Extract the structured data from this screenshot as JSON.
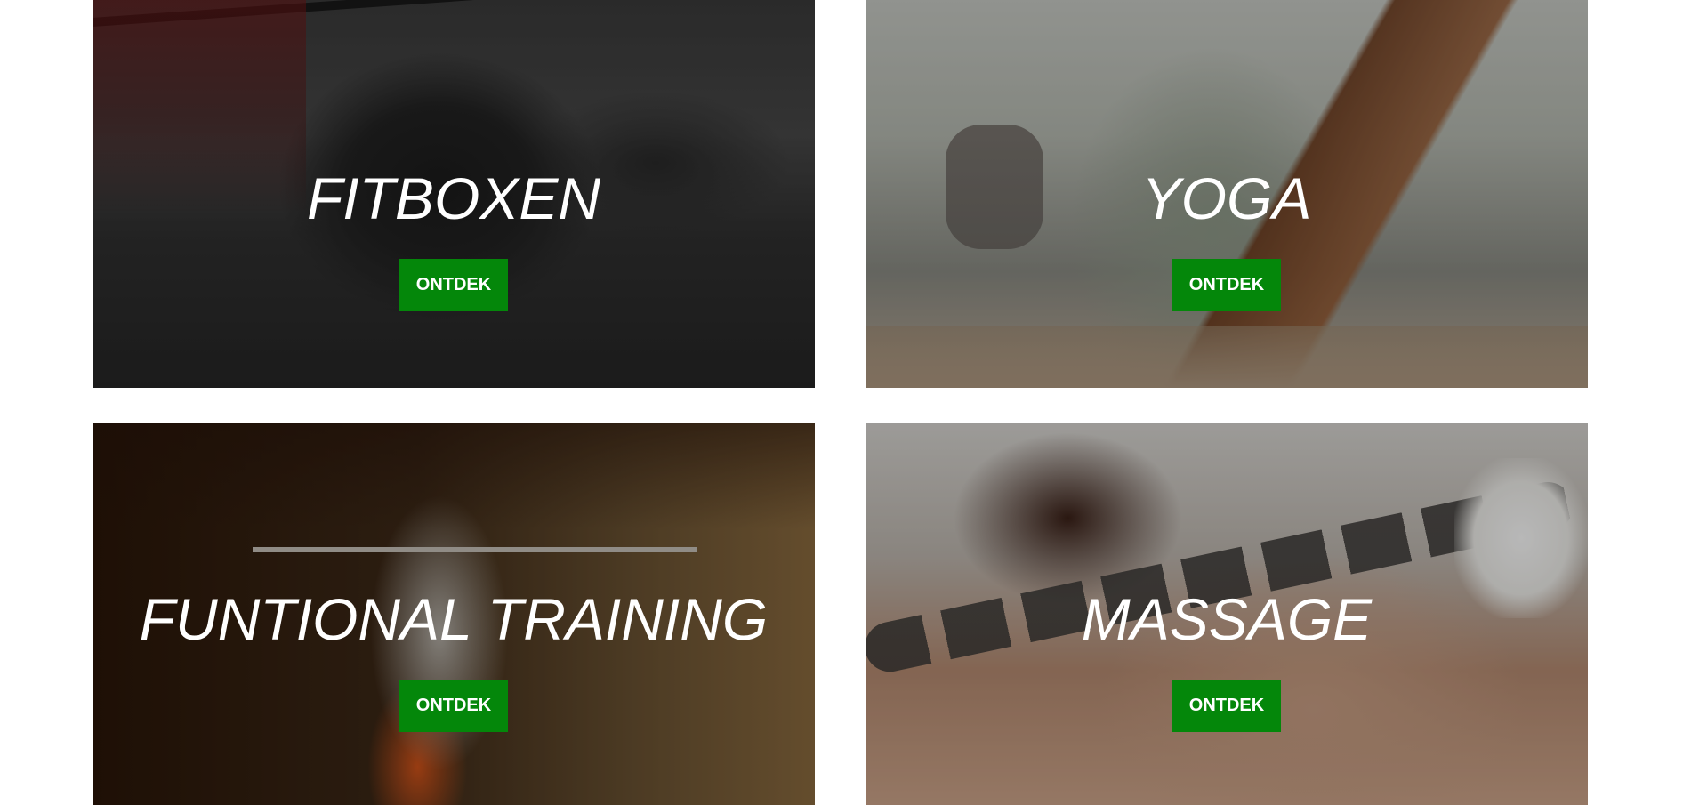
{
  "cards": [
    {
      "title": "FITBOXEN",
      "button": "ONTDEK"
    },
    {
      "title": "YOGA",
      "button": "ONTDEK"
    },
    {
      "title": "FUNTIONAL TRAINING",
      "button": "ONTDEK"
    },
    {
      "title": "MASSAGE",
      "button": "ONTDEK"
    }
  ],
  "colors": {
    "button_bg": "#04870a",
    "button_text": "#ffffff",
    "title_text": "#ffffff",
    "page_bg": "#ffffff"
  }
}
